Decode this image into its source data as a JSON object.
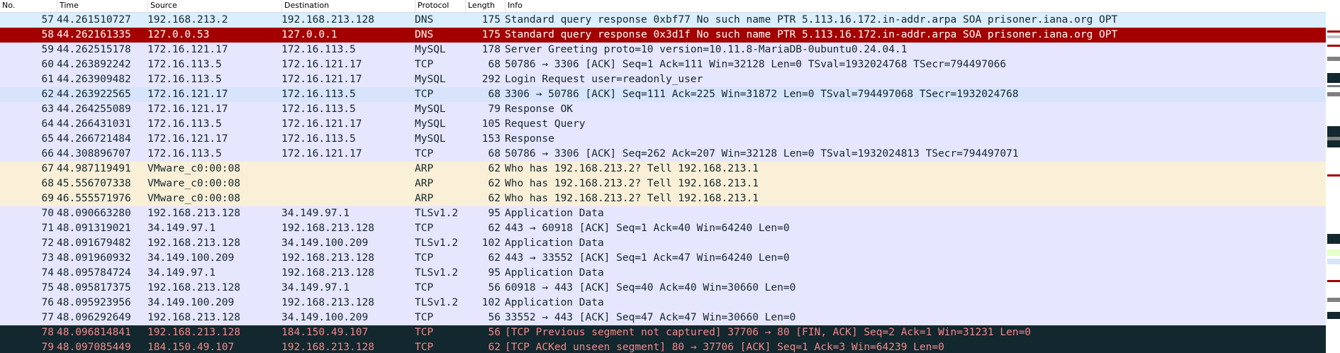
{
  "columns": [
    "No.",
    "Time",
    "Source",
    "Destination",
    "Protocol",
    "Length",
    "Info"
  ],
  "colors": {
    "dns": "#daeeff",
    "selected": "#a40000",
    "selected_text": "#ffffff",
    "mysql_tcp": "#e7e6ff",
    "tcp_alt": "#d7e4fb",
    "arp": "#faf0d7",
    "tls": "#e7e6ff",
    "bad_tcp": "#12272e",
    "bad_tcp_text": "#f78787",
    "default_text": "#12272e"
  },
  "rows": [
    {
      "no": "57",
      "time": "44.261510727",
      "src": "192.168.213.2",
      "dst": "192.168.213.128",
      "proto": "DNS",
      "len": "175",
      "info": "Standard query response 0xbf77 No such name PTR 5.113.16.172.in-addr.arpa SOA prisoner.iana.org OPT",
      "bg": "#daeeff",
      "fg": "#12272e"
    },
    {
      "no": "58",
      "time": "44.262161335",
      "src": "127.0.0.53",
      "dst": "127.0.0.1",
      "proto": "DNS",
      "len": "175",
      "info": "Standard query response 0x3d1f No such name PTR 5.113.16.172.in-addr.arpa SOA prisoner.iana.org OPT",
      "bg": "#a40000",
      "fg": "#ffffff"
    },
    {
      "no": "59",
      "time": "44.262515178",
      "src": "172.16.121.17",
      "dst": "172.16.113.5",
      "proto": "MySQL",
      "len": "178",
      "info": "Server Greeting proto=10 version=10.11.8-MariaDB-0ubuntu0.24.04.1",
      "bg": "#e7e6ff",
      "fg": "#12272e"
    },
    {
      "no": "60",
      "time": "44.263892242",
      "src": "172.16.113.5",
      "dst": "172.16.121.17",
      "proto": "TCP",
      "len": "68",
      "info": "50786 → 3306 [ACK] Seq=1 Ack=111 Win=32128 Len=0 TSval=1932024768 TSecr=794497066",
      "bg": "#e7e6ff",
      "fg": "#12272e"
    },
    {
      "no": "61",
      "time": "44.263909482",
      "src": "172.16.113.5",
      "dst": "172.16.121.17",
      "proto": "MySQL",
      "len": "292",
      "info": "Login Request user=readonly_user",
      "bg": "#e7e6ff",
      "fg": "#12272e"
    },
    {
      "no": "62",
      "time": "44.263922565",
      "src": "172.16.121.17",
      "dst": "172.16.113.5",
      "proto": "TCP",
      "len": "68",
      "info": "3306 → 50786 [ACK] Seq=111 Ack=225 Win=31872 Len=0 TSval=794497068 TSecr=1932024768",
      "bg": "#d7e4fb",
      "fg": "#12272e"
    },
    {
      "no": "63",
      "time": "44.264255089",
      "src": "172.16.121.17",
      "dst": "172.16.113.5",
      "proto": "MySQL",
      "len": "79",
      "info": "Response OK",
      "bg": "#e7e6ff",
      "fg": "#12272e"
    },
    {
      "no": "64",
      "time": "44.266431031",
      "src": "172.16.113.5",
      "dst": "172.16.121.17",
      "proto": "MySQL",
      "len": "105",
      "info": "Request Query",
      "bg": "#e7e6ff",
      "fg": "#12272e"
    },
    {
      "no": "65",
      "time": "44.266721484",
      "src": "172.16.121.17",
      "dst": "172.16.113.5",
      "proto": "MySQL",
      "len": "153",
      "info": "Response",
      "bg": "#e7e6ff",
      "fg": "#12272e"
    },
    {
      "no": "66",
      "time": "44.308896707",
      "src": "172.16.113.5",
      "dst": "172.16.121.17",
      "proto": "TCP",
      "len": "68",
      "info": "50786 → 3306 [ACK] Seq=262 Ack=207 Win=32128 Len=0 TSval=1932024813 TSecr=794497071",
      "bg": "#e7e6ff",
      "fg": "#12272e"
    },
    {
      "no": "67",
      "time": "44.987119491",
      "src": "VMware_c0:00:08",
      "dst": "",
      "proto": "ARP",
      "len": "62",
      "info": "Who has 192.168.213.2? Tell 192.168.213.1",
      "bg": "#faf0d7",
      "fg": "#12272e"
    },
    {
      "no": "68",
      "time": "45.556707338",
      "src": "VMware_c0:00:08",
      "dst": "",
      "proto": "ARP",
      "len": "62",
      "info": "Who has 192.168.213.2? Tell 192.168.213.1",
      "bg": "#faf0d7",
      "fg": "#12272e"
    },
    {
      "no": "69",
      "time": "46.555571976",
      "src": "VMware_c0:00:08",
      "dst": "",
      "proto": "ARP",
      "len": "62",
      "info": "Who has 192.168.213.2? Tell 192.168.213.1",
      "bg": "#faf0d7",
      "fg": "#12272e"
    },
    {
      "no": "70",
      "time": "48.090663280",
      "src": "192.168.213.128",
      "dst": "34.149.97.1",
      "proto": "TLSv1.2",
      "len": "95",
      "info": "Application Data",
      "bg": "#e7e6ff",
      "fg": "#12272e"
    },
    {
      "no": "71",
      "time": "48.091319021",
      "src": "34.149.97.1",
      "dst": "192.168.213.128",
      "proto": "TCP",
      "len": "62",
      "info": "443 → 60918 [ACK] Seq=1 Ack=40 Win=64240 Len=0",
      "bg": "#e7e6ff",
      "fg": "#12272e"
    },
    {
      "no": "72",
      "time": "48.091679482",
      "src": "192.168.213.128",
      "dst": "34.149.100.209",
      "proto": "TLSv1.2",
      "len": "102",
      "info": "Application Data",
      "bg": "#e7e6ff",
      "fg": "#12272e"
    },
    {
      "no": "73",
      "time": "48.091960932",
      "src": "34.149.100.209",
      "dst": "192.168.213.128",
      "proto": "TCP",
      "len": "62",
      "info": "443 → 33552 [ACK] Seq=1 Ack=47 Win=64240 Len=0",
      "bg": "#e7e6ff",
      "fg": "#12272e"
    },
    {
      "no": "74",
      "time": "48.095784724",
      "src": "34.149.97.1",
      "dst": "192.168.213.128",
      "proto": "TLSv1.2",
      "len": "95",
      "info": "Application Data",
      "bg": "#e7e6ff",
      "fg": "#12272e"
    },
    {
      "no": "75",
      "time": "48.095817375",
      "src": "192.168.213.128",
      "dst": "34.149.97.1",
      "proto": "TCP",
      "len": "56",
      "info": "60918 → 443 [ACK] Seq=40 Ack=40 Win=30660 Len=0",
      "bg": "#e7e6ff",
      "fg": "#12272e"
    },
    {
      "no": "76",
      "time": "48.095923956",
      "src": "34.149.100.209",
      "dst": "192.168.213.128",
      "proto": "TLSv1.2",
      "len": "102",
      "info": "Application Data",
      "bg": "#e7e6ff",
      "fg": "#12272e"
    },
    {
      "no": "77",
      "time": "48.096292649",
      "src": "192.168.213.128",
      "dst": "34.149.100.209",
      "proto": "TCP",
      "len": "56",
      "info": "33552 → 443 [ACK] Seq=47 Ack=47 Win=30660 Len=0",
      "bg": "#e7e6ff",
      "fg": "#12272e"
    },
    {
      "no": "78",
      "time": "48.096814841",
      "src": "192.168.213.128",
      "dst": "184.150.49.107",
      "proto": "TCP",
      "len": "56",
      "info": "[TCP Previous segment not captured] 37706 → 80 [FIN, ACK] Seq=2 Ack=1 Win=31231 Len=0",
      "bg": "#12272e",
      "fg": "#f78787"
    },
    {
      "no": "79",
      "time": "48.097085449",
      "src": "184.150.49.107",
      "dst": "192.168.213.128",
      "proto": "TCP",
      "len": "62",
      "info": "[TCP ACKed unseen segment] 80 → 37706 [ACK] Seq=1 Ack=3 Win=64239 Len=0",
      "bg": "#12272e",
      "fg": "#f78787"
    }
  ],
  "minimap_marks": [
    {
      "color": "#a40000"
    },
    {
      "color": "#c0c0c0"
    },
    {
      "color": "#a40000"
    },
    {
      "color": "#7f7f7f"
    },
    {
      "color": "#12272e"
    },
    {
      "color": "#7f7f7f"
    },
    {
      "color": "#7f7f7f"
    },
    {
      "color": "#12272e"
    },
    {
      "color": "#7f7f7f"
    },
    {
      "color": "#a40000"
    },
    {
      "color": "#12272e"
    },
    {
      "color": "#e4ffc7"
    },
    {
      "color": "#d7e4fb"
    },
    {
      "color": "#a40000"
    },
    {
      "color": "#7f7f7f"
    },
    {
      "color": "#12272e"
    }
  ]
}
